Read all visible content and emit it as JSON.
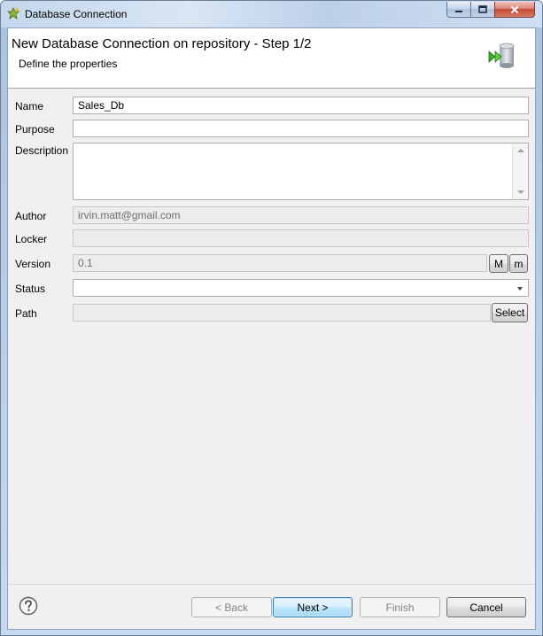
{
  "window": {
    "title": "Database Connection",
    "minimize_icon": "minimize-icon",
    "maximize_icon": "maximize-icon",
    "close_icon": "close-icon"
  },
  "header": {
    "title": "New Database Connection on repository - Step 1/2",
    "subtitle": "Define the properties",
    "icon": "database-connection-icon"
  },
  "form": {
    "name": {
      "label": "Name",
      "value": "Sales_Db"
    },
    "purpose": {
      "label": "Purpose",
      "value": ""
    },
    "description": {
      "label": "Description",
      "value": ""
    },
    "author": {
      "label": "Author",
      "value": "irvin.matt@gmail.com"
    },
    "locker": {
      "label": "Locker",
      "value": ""
    },
    "version": {
      "label": "Version",
      "value": "0.1",
      "major_label": "M",
      "minor_label": "m"
    },
    "status": {
      "label": "Status",
      "value": ""
    },
    "path": {
      "label": "Path",
      "value": "",
      "select_label": "Select"
    }
  },
  "footer": {
    "help_icon": "help-icon",
    "back_label": "< Back",
    "next_label": "Next >",
    "finish_label": "Finish",
    "cancel_label": "Cancel"
  },
  "colors": {
    "default_button_border": "#3c7fb1",
    "disabled_field_bg": "#ececec",
    "dialog_bg": "#f0f0f0"
  }
}
